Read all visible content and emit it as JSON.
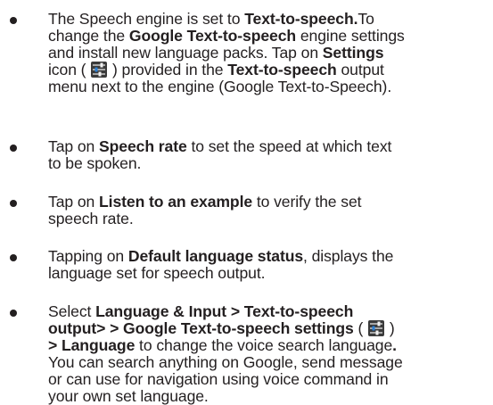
{
  "items": [
    {
      "lines": [
        [
          {
            "t": "The Speech engine is set to "
          },
          {
            "t": "Text-to-speech.",
            "b": true
          },
          {
            "t": "To"
          }
        ],
        [
          {
            "t": "change the "
          },
          {
            "t": "Google Text-to-speech",
            "b": true
          },
          {
            "t": " engine settings"
          }
        ],
        [
          {
            "t": "and install new language packs. Tap on "
          },
          {
            "t": "Settings",
            "b": true
          }
        ],
        [
          {
            "t": "icon ( "
          },
          {
            "icon": "settings-sliders-icon"
          },
          {
            "t": " ) provided in the "
          },
          {
            "t": "Text-to-speech",
            "b": true
          },
          {
            "t": " output"
          }
        ],
        [
          {
            "t": "menu next to the engine (Google Text-to-Speech)."
          }
        ]
      ]
    },
    {
      "lines": [
        [
          {
            "t": "Tap on "
          },
          {
            "t": "Speech rate",
            "b": true
          },
          {
            "t": "  to set the speed at which text"
          }
        ],
        [
          {
            "t": "to be spoken."
          }
        ]
      ]
    },
    {
      "lines": [
        [
          {
            "t": "Tap on "
          },
          {
            "t": "Listen to an example",
            "b": true
          },
          {
            "t": " to verify the set"
          }
        ],
        [
          {
            "t": "speech rate."
          }
        ]
      ]
    },
    {
      "lines": [
        [
          {
            "t": "Tapping on "
          },
          {
            "t": "Default language status",
            "b": true
          },
          {
            "t": ", displays the"
          }
        ],
        [
          {
            "t": "language set for speech output."
          }
        ]
      ]
    },
    {
      "lines": [
        [
          {
            "t": "Select "
          },
          {
            "t": "Language & Input > Text-to-speech",
            "b": true
          }
        ],
        [
          {
            "t": "output> > Google Text-to-speech settings",
            "b": true
          },
          {
            "t": " ( "
          },
          {
            "icon": "settings-sliders-icon"
          },
          {
            "t": " )"
          }
        ],
        [
          {
            "t": "> Language",
            "b": true
          },
          {
            "t": " to change the voice search language"
          },
          {
            "t": ".",
            "b": true
          }
        ],
        [
          {
            "t": "You can search anything on Google, send message"
          }
        ],
        [
          {
            "t": "or can use for navigation using voice command in"
          }
        ],
        [
          {
            "t": "your own set language."
          }
        ]
      ]
    }
  ],
  "colors": {
    "text": "#231f20",
    "icon_bg": "#3a3a3a",
    "icon_accent": "#2a7fd4"
  }
}
